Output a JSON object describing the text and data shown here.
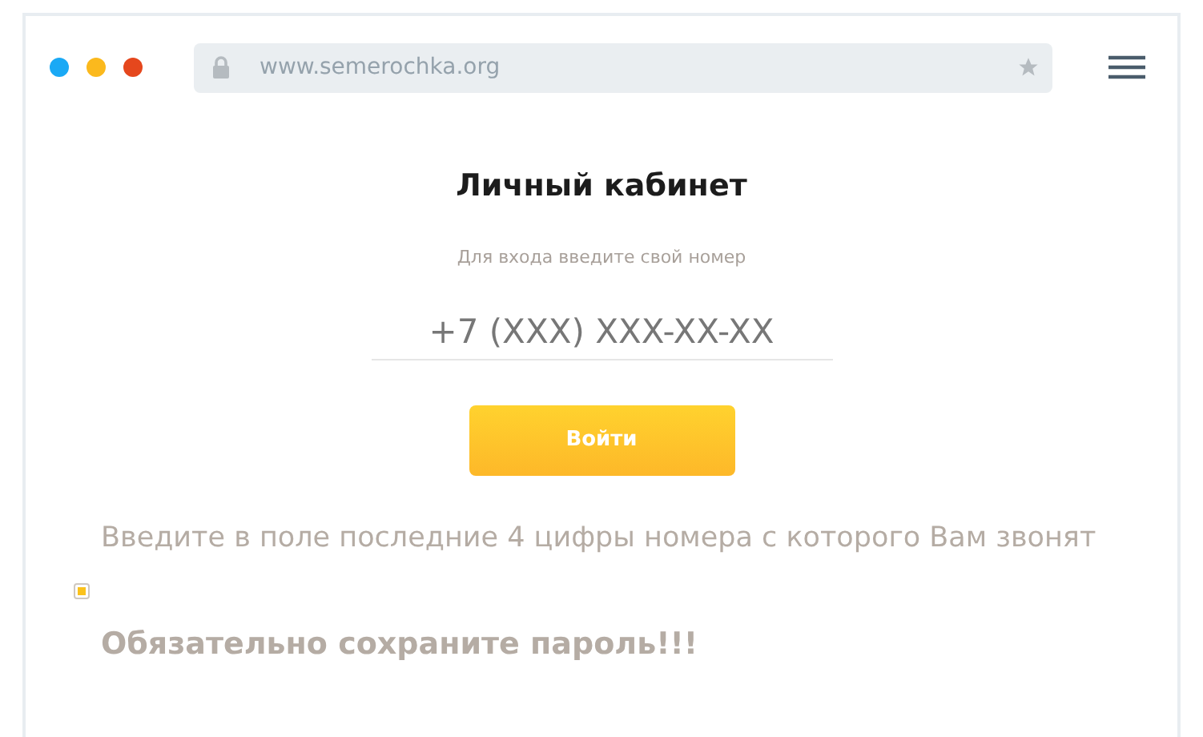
{
  "browser": {
    "url": "www.semerochka.org"
  },
  "page": {
    "title": "Личный кабинет",
    "hint": "Для входа введите свой номер",
    "phone_field": {
      "placeholder": "+7 (XXX) XXX-XX-XX"
    },
    "button": "Войти",
    "instruction": "Введите в поле последние 4 цифры номера с которого Вам звонят",
    "warning": "Обязательно сохраните пароль!!!"
  }
}
